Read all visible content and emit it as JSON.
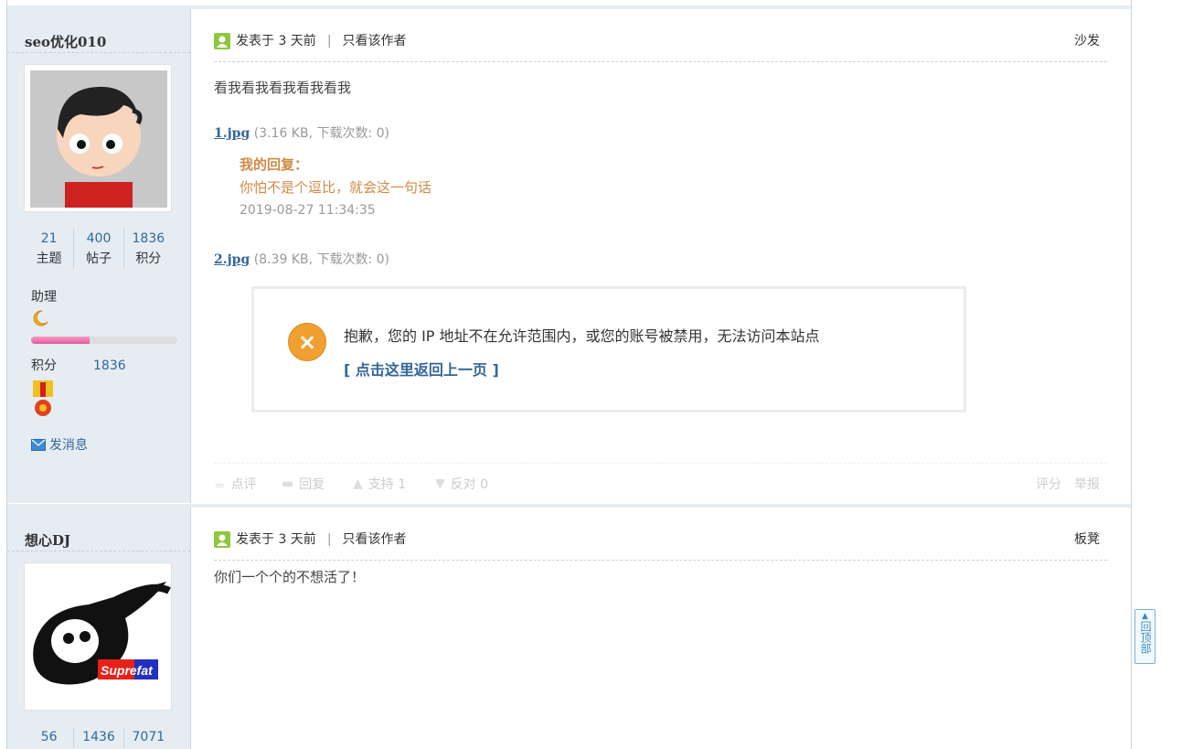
{
  "posts": [
    {
      "author": "seo优化010",
      "avatar": "cartoon-boy-avatar",
      "stats": [
        {
          "num": "21",
          "label": "主题"
        },
        {
          "num": "400",
          "label": "帖子"
        },
        {
          "num": "1836",
          "label": "积分"
        }
      ],
      "rank": "助理",
      "rank_progress": 0.4,
      "credit_label": "积分",
      "credit_value": "1836",
      "pm": "发消息",
      "posted": "发表于 3 天前",
      "only_author": "只看该作者",
      "floor": "沙发",
      "content": "看我看我看我看我看我",
      "attachments": [
        {
          "name": "1.jpg",
          "info": "(3.16 KB, 下载次数: 0)"
        },
        {
          "name": "2.jpg",
          "info": "(8.39 KB, 下载次数: 0)"
        }
      ],
      "reply": {
        "title": "我的回复：",
        "content": "你怕不是个逗比，就会这一句话",
        "date": "2019-08-27 11:34:35"
      },
      "error": {
        "message": "抱歉，您的 IP 地址不在允许范围内，或您的账号被禁用，无法访问本站点",
        "link": "[ 点击这里返回上一页 ]"
      },
      "actions": {
        "comment": "点评",
        "reply": "回复",
        "support": "支持 1",
        "oppose": "反对 0",
        "rate": "评分",
        "report": "举报"
      }
    },
    {
      "author": "想心DJ",
      "avatar": "panda-suprefat-avatar",
      "avatar_text": "Suprefat",
      "stats": [
        {
          "num": "56"
        },
        {
          "num": "1436"
        },
        {
          "num": "7071"
        }
      ],
      "posted": "发表于 3 天前",
      "only_author": "只看该作者",
      "floor": "板凳",
      "content": "你们一个个的不想活了！"
    }
  ],
  "back_to_top": "回顶部"
}
